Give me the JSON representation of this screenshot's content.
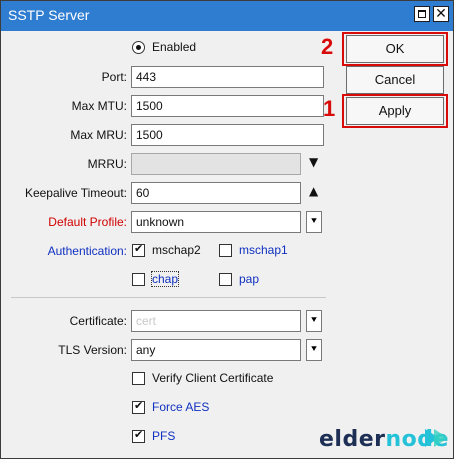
{
  "window": {
    "title": "SSTP Server"
  },
  "form": {
    "enabled_label": "Enabled",
    "port": {
      "label": "Port:",
      "value": "443"
    },
    "max_mtu": {
      "label": "Max MTU:",
      "value": "1500"
    },
    "max_mru": {
      "label": "Max MRU:",
      "value": "1500"
    },
    "mrru": {
      "label": "MRRU:",
      "value": ""
    },
    "keepalive": {
      "label": "Keepalive Timeout:",
      "value": "60"
    },
    "default_profile": {
      "label": "Default Profile:",
      "value": "unknown"
    },
    "authentication": {
      "label": "Authentication:",
      "options": [
        {
          "label": "mschap2",
          "checked": true
        },
        {
          "label": "mschap1",
          "checked": false
        },
        {
          "label": "chap",
          "checked": false
        },
        {
          "label": "pap",
          "checked": false
        }
      ]
    },
    "certificate": {
      "label": "Certificate:",
      "value": "cert"
    },
    "tls_version": {
      "label": "TLS Version:",
      "value": "any"
    },
    "verify_client_cert": {
      "label": "Verify Client Certificate",
      "checked": false
    },
    "force_aes": {
      "label": "Force AES",
      "checked": true
    },
    "pfs": {
      "label": "PFS",
      "checked": true
    }
  },
  "buttons": {
    "ok": "OK",
    "cancel": "Cancel",
    "apply": "Apply"
  },
  "annotations": {
    "ok_step": "2",
    "apply_step": "1",
    "highlight_color": "#d90a0a"
  },
  "branding": {
    "part1": "elder",
    "part2": "node"
  },
  "colors": {
    "titlebar": "#2f7dd1",
    "required_label": "#d10000",
    "auth_label": "#1030c0"
  }
}
